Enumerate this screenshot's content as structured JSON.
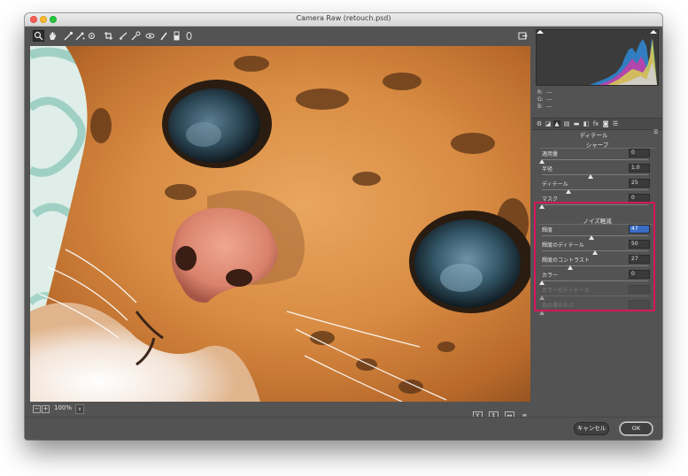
{
  "window": {
    "title": "Camera Raw (retouch.psd)"
  },
  "toolbar": {
    "tools": [
      {
        "name": "zoom-tool",
        "glyph": "🔍"
      },
      {
        "name": "hand-tool",
        "glyph": "✋"
      },
      {
        "name": "white-balance-tool",
        "glyph": "✐"
      },
      {
        "name": "color-sampler-tool",
        "glyph": "✐"
      },
      {
        "name": "targeted-adjustment-tool",
        "glyph": "◎"
      },
      {
        "name": "crop-tool",
        "glyph": "⌗"
      },
      {
        "name": "straighten-tool",
        "glyph": "⁄"
      },
      {
        "name": "spot-removal-tool",
        "glyph": "✵"
      },
      {
        "name": "red-eye-tool",
        "glyph": "☉"
      },
      {
        "name": "adjustment-brush-tool",
        "glyph": "✒"
      },
      {
        "name": "graduated-filter-tool",
        "glyph": "▮"
      },
      {
        "name": "radial-filter-tool",
        "glyph": "○"
      }
    ],
    "open_preferences_glyph": "⇱"
  },
  "canvas": {
    "zoom_level": "100%",
    "zoom_out": "−",
    "zoom_in": "+",
    "zoom_dropdown": "∨",
    "footer_buttons": [
      "Y",
      "↕",
      "↔",
      "≡"
    ]
  },
  "histogram": {
    "r_label": "R:",
    "g_label": "G:",
    "b_label": "B:",
    "r_value": "---",
    "g_value": "---",
    "b_value": "---"
  },
  "panel": {
    "title": "ディテール",
    "sharpen": {
      "title": "シャープ",
      "rows": [
        {
          "label": "適用量",
          "value": "0",
          "level": 0.0
        },
        {
          "label": "半径",
          "value": "1.0",
          "level": 0.46
        },
        {
          "label": "ディテール",
          "value": "25",
          "level": 0.25
        },
        {
          "label": "マスク",
          "value": "0",
          "level": 0.0
        }
      ]
    },
    "noise": {
      "title": "ノイズ軽減",
      "rows": [
        {
          "label": "輝度",
          "value": "47",
          "level": 0.47,
          "selected": true
        },
        {
          "label": "輝度のディテール",
          "value": "50",
          "level": 0.5
        },
        {
          "label": "輝度のコントラスト",
          "value": "27",
          "level": 0.27
        },
        {
          "label": "カラー",
          "value": "0",
          "level": 0.0
        },
        {
          "label": "カラーのディテール",
          "value": "",
          "level": 0.0,
          "disabled": true
        },
        {
          "label": "色の滑らかさ",
          "value": "",
          "level": 0.0,
          "disabled": true
        }
      ]
    }
  },
  "footer": {
    "cancel_label": "キャンセル",
    "ok_label": "OK"
  },
  "colors": {
    "highlight": "#d8165b",
    "selected_field": "#3a6cc6",
    "window_bg": "#535353"
  }
}
